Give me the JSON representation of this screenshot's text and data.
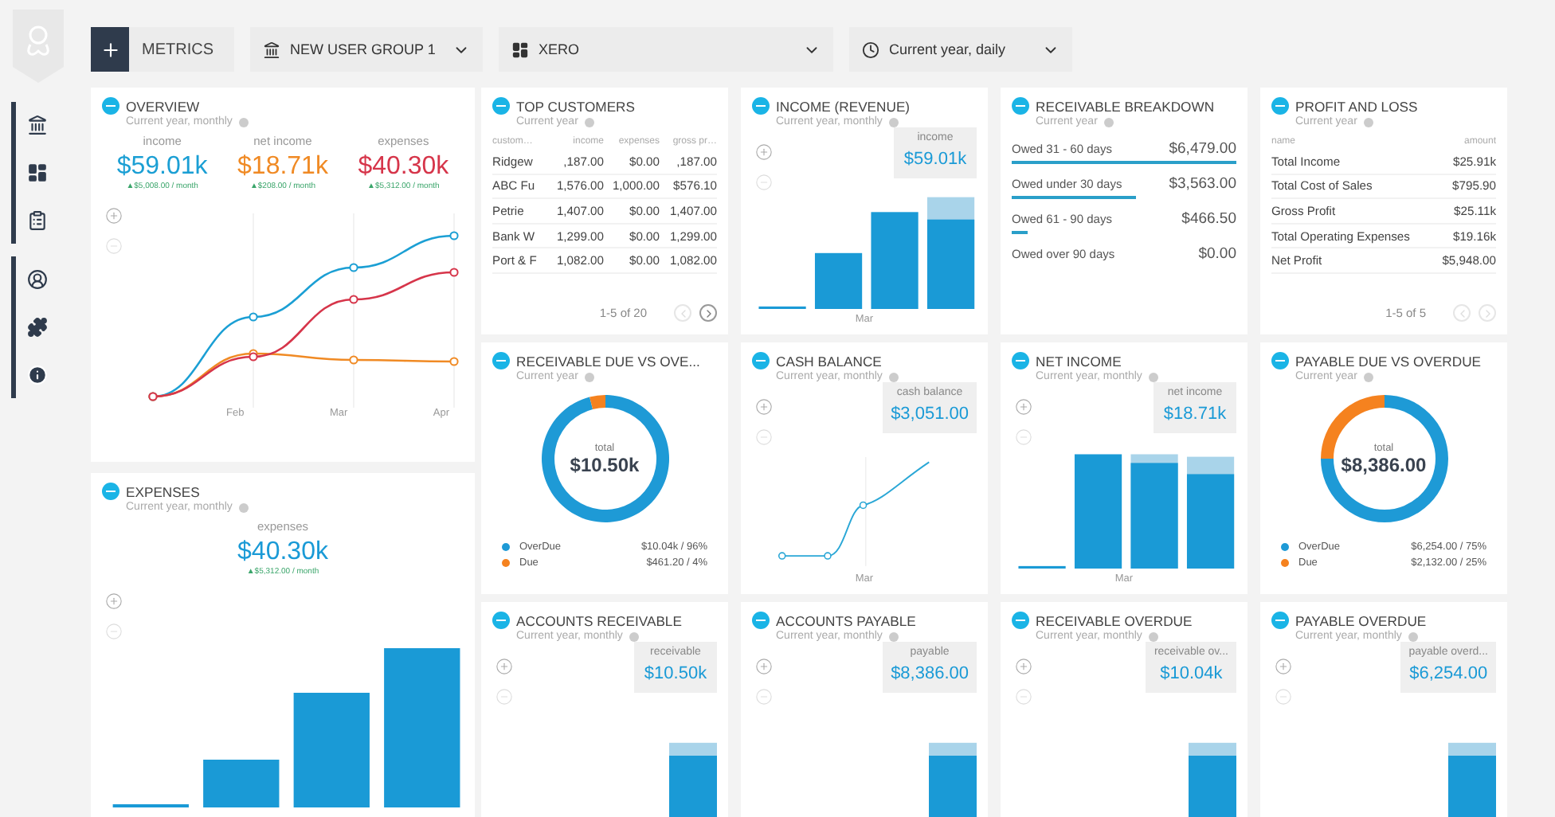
{
  "toolbar": {
    "metrics": "METRICS",
    "group": "NEW USER GROUP 1",
    "source": "XERO",
    "period": "Current year, daily"
  },
  "overview": {
    "title": "OVERVIEW",
    "subtitle": "Current year, monthly",
    "stats": [
      {
        "label": "income",
        "value": "$59.01k",
        "change": "▲$5,008.00 / month",
        "color": "#1b9fd4"
      },
      {
        "label": "net income",
        "value": "$18.71k",
        "change": "▲$208.00 / month",
        "color": "#f08a24"
      },
      {
        "label": "expenses",
        "value": "$40.30k",
        "change": "▲$5,312.00 / month",
        "color": "#d6354a"
      }
    ],
    "x_labels": [
      "Feb",
      "Mar",
      "Apr"
    ]
  },
  "expenses": {
    "title": "EXPENSES",
    "subtitle": "Current year, monthly",
    "stat": {
      "label": "expenses",
      "value": "$40.30k",
      "change": "▲$5,312.00 / month"
    }
  },
  "cards": [
    {
      "kind": "table",
      "title": "TOP CUSTOMERS",
      "subtitle": "Current year",
      "columns": [
        "custom…",
        "income",
        "expenses",
        "gross pr…"
      ],
      "rows": [
        [
          "Ridgew",
          ",187.00",
          "$0.00",
          ",187.00"
        ],
        [
          "ABC Fu",
          "1,576.00",
          "1,000.00",
          "$576.10"
        ],
        [
          "Petrie",
          "1,407.00",
          "$0.00",
          "1,407.00"
        ],
        [
          "Bank W",
          "1,299.00",
          "$0.00",
          "1,299.00"
        ],
        [
          "Port & F",
          "1,082.00",
          "$0.00",
          "1,082.00"
        ]
      ],
      "pager": {
        "label": "1-5 of 20",
        "prev_disabled": true,
        "next_disabled": false
      }
    },
    {
      "kind": "bars",
      "title": "INCOME (REVENUE)",
      "subtitle": "Current year, monthly",
      "tooltip": {
        "label": "income",
        "value": "$59.01k"
      },
      "x_label": "Mar"
    },
    {
      "kind": "breakdown",
      "title": "RECEIVABLE BREAKDOWN",
      "subtitle": "Current year",
      "rows": [
        {
          "label": "Owed 31 - 60 days",
          "value": "$6,479.00"
        },
        {
          "label": "Owed under 30 days",
          "value": "$3,563.00"
        },
        {
          "label": "Owed 61 - 90 days",
          "value": "$466.50"
        },
        {
          "label": "Owed over 90 days",
          "value": "$0.00"
        }
      ]
    },
    {
      "kind": "pnl",
      "title": "PROFIT AND LOSS",
      "subtitle": "Current year",
      "columns": [
        "name",
        "amount"
      ],
      "rows": [
        [
          "Total Income",
          "$25.91k"
        ],
        [
          "Total Cost of Sales",
          "$795.90"
        ],
        [
          "Gross Profit",
          "$25.11k"
        ],
        [
          "Total Operating Expenses",
          "$19.16k"
        ],
        [
          "Net Profit",
          "$5,948.00"
        ]
      ],
      "pager": {
        "label": "1-5 of 5",
        "prev_disabled": true,
        "next_disabled": true
      }
    },
    {
      "kind": "donut",
      "title": "RECEIVABLE DUE VS OVE...",
      "subtitle": "Current year",
      "total_label": "total",
      "total": "$10.50k",
      "legend": [
        {
          "value": "$10.04k / 96%",
          "color": "#1e9ad6"
        },
        {
          "value": "$461.20 / 4%",
          "color": "#f5821f"
        }
      ],
      "chart_data": {
        "type": "donut",
        "categories": [
          "OverDue",
          "Due"
        ],
        "series": [
          {
            "values": [
              96,
              4
            ]
          }
        ]
      }
    },
    {
      "kind": "line",
      "title": "CASH BALANCE",
      "subtitle": "Current year, monthly",
      "tooltip": {
        "label": "cash balance",
        "value": "$3,051.00"
      },
      "x_label": "Mar"
    },
    {
      "kind": "steps",
      "title": "NET INCOME",
      "subtitle": "Current year, monthly",
      "tooltip": {
        "label": "net income",
        "value": "$18.71k"
      },
      "x_label": "Mar"
    },
    {
      "kind": "donut",
      "title": "PAYABLE DUE VS OVERDUE",
      "subtitle": "Current year",
      "total_label": "total",
      "total": "$8,386.00",
      "legend": [
        {
          "value": "$6,254.00 / 75%",
          "color": "#1e9ad6"
        },
        {
          "value": "$2,132.00 / 25%",
          "color": "#f5821f"
        }
      ],
      "chart_data": {
        "type": "donut",
        "categories": [
          "OverDue",
          "Due"
        ],
        "series": [
          {
            "values": [
              75,
              25
            ]
          }
        ]
      }
    },
    {
      "kind": "snapshot",
      "title": "ACCOUNTS RECEIVABLE",
      "subtitle": "Current year, monthly",
      "tooltip": {
        "label": "receivable",
        "value": "$10.50k"
      }
    },
    {
      "kind": "snapshot",
      "title": "ACCOUNTS PAYABLE",
      "subtitle": "Current year, monthly",
      "tooltip": {
        "label": "payable",
        "value": "$8,386.00"
      }
    },
    {
      "kind": "snapshot",
      "title": "RECEIVABLE OVERDUE",
      "subtitle": "Current year, monthly",
      "tooltip": {
        "label": "receivable ov...",
        "value": "$10.04k"
      }
    },
    {
      "kind": "snapshot",
      "title": "PAYABLE OVERDUE",
      "subtitle": "Current year, monthly",
      "tooltip": {
        "label": "payable overd...",
        "value": "$6,254.00"
      }
    }
  ]
}
